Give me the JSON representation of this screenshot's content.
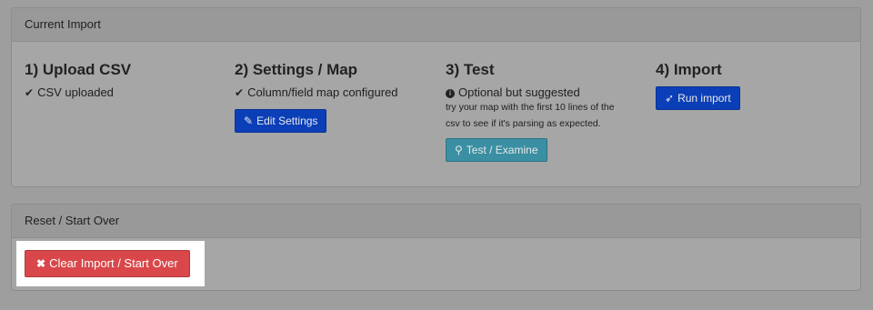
{
  "import_panel": {
    "title": "Current Import",
    "steps": [
      {
        "title": "1) Upload CSV",
        "status": "CSV uploaded"
      },
      {
        "title": "2) Settings / Map",
        "status": "Column/field map configured",
        "button": "Edit Settings"
      },
      {
        "title": "3) Test",
        "status": "Optional but suggested",
        "note_line1": "try your map with the first 10 lines of the",
        "note_line2": "csv to see if it's parsing as expected.",
        "button": "Test / Examine"
      },
      {
        "title": "4) Import",
        "button": "Run import"
      }
    ]
  },
  "reset_panel": {
    "title": "Reset / Start Over",
    "button": "Clear Import / Start Over"
  },
  "icons": {
    "check": "check-icon",
    "edit": "edit-icon",
    "info": "info-icon",
    "search": "search-icon",
    "rocket": "rocket-icon",
    "close": "close-icon"
  },
  "colors": {
    "primary": "#0b3fb8",
    "info": "#3a8fa3",
    "danger": "#d9474a"
  }
}
